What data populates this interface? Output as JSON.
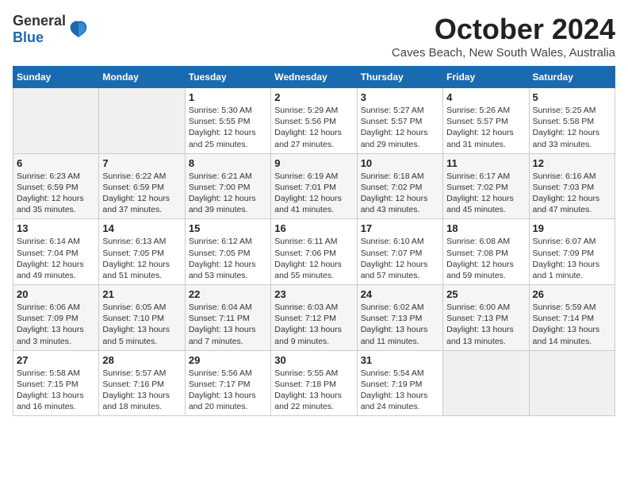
{
  "header": {
    "logo_general": "General",
    "logo_blue": "Blue",
    "month_title": "October 2024",
    "location": "Caves Beach, New South Wales, Australia"
  },
  "days_of_week": [
    "Sunday",
    "Monday",
    "Tuesday",
    "Wednesday",
    "Thursday",
    "Friday",
    "Saturday"
  ],
  "weeks": [
    [
      {
        "day": "",
        "info": ""
      },
      {
        "day": "",
        "info": ""
      },
      {
        "day": "1",
        "info": "Sunrise: 5:30 AM\nSunset: 5:55 PM\nDaylight: 12 hours and 25 minutes."
      },
      {
        "day": "2",
        "info": "Sunrise: 5:29 AM\nSunset: 5:56 PM\nDaylight: 12 hours and 27 minutes."
      },
      {
        "day": "3",
        "info": "Sunrise: 5:27 AM\nSunset: 5:57 PM\nDaylight: 12 hours and 29 minutes."
      },
      {
        "day": "4",
        "info": "Sunrise: 5:26 AM\nSunset: 5:57 PM\nDaylight: 12 hours and 31 minutes."
      },
      {
        "day": "5",
        "info": "Sunrise: 5:25 AM\nSunset: 5:58 PM\nDaylight: 12 hours and 33 minutes."
      }
    ],
    [
      {
        "day": "6",
        "info": "Sunrise: 6:23 AM\nSunset: 6:59 PM\nDaylight: 12 hours and 35 minutes."
      },
      {
        "day": "7",
        "info": "Sunrise: 6:22 AM\nSunset: 6:59 PM\nDaylight: 12 hours and 37 minutes."
      },
      {
        "day": "8",
        "info": "Sunrise: 6:21 AM\nSunset: 7:00 PM\nDaylight: 12 hours and 39 minutes."
      },
      {
        "day": "9",
        "info": "Sunrise: 6:19 AM\nSunset: 7:01 PM\nDaylight: 12 hours and 41 minutes."
      },
      {
        "day": "10",
        "info": "Sunrise: 6:18 AM\nSunset: 7:02 PM\nDaylight: 12 hours and 43 minutes."
      },
      {
        "day": "11",
        "info": "Sunrise: 6:17 AM\nSunset: 7:02 PM\nDaylight: 12 hours and 45 minutes."
      },
      {
        "day": "12",
        "info": "Sunrise: 6:16 AM\nSunset: 7:03 PM\nDaylight: 12 hours and 47 minutes."
      }
    ],
    [
      {
        "day": "13",
        "info": "Sunrise: 6:14 AM\nSunset: 7:04 PM\nDaylight: 12 hours and 49 minutes."
      },
      {
        "day": "14",
        "info": "Sunrise: 6:13 AM\nSunset: 7:05 PM\nDaylight: 12 hours and 51 minutes."
      },
      {
        "day": "15",
        "info": "Sunrise: 6:12 AM\nSunset: 7:05 PM\nDaylight: 12 hours and 53 minutes."
      },
      {
        "day": "16",
        "info": "Sunrise: 6:11 AM\nSunset: 7:06 PM\nDaylight: 12 hours and 55 minutes."
      },
      {
        "day": "17",
        "info": "Sunrise: 6:10 AM\nSunset: 7:07 PM\nDaylight: 12 hours and 57 minutes."
      },
      {
        "day": "18",
        "info": "Sunrise: 6:08 AM\nSunset: 7:08 PM\nDaylight: 12 hours and 59 minutes."
      },
      {
        "day": "19",
        "info": "Sunrise: 6:07 AM\nSunset: 7:09 PM\nDaylight: 13 hours and 1 minute."
      }
    ],
    [
      {
        "day": "20",
        "info": "Sunrise: 6:06 AM\nSunset: 7:09 PM\nDaylight: 13 hours and 3 minutes."
      },
      {
        "day": "21",
        "info": "Sunrise: 6:05 AM\nSunset: 7:10 PM\nDaylight: 13 hours and 5 minutes."
      },
      {
        "day": "22",
        "info": "Sunrise: 6:04 AM\nSunset: 7:11 PM\nDaylight: 13 hours and 7 minutes."
      },
      {
        "day": "23",
        "info": "Sunrise: 6:03 AM\nSunset: 7:12 PM\nDaylight: 13 hours and 9 minutes."
      },
      {
        "day": "24",
        "info": "Sunrise: 6:02 AM\nSunset: 7:13 PM\nDaylight: 13 hours and 11 minutes."
      },
      {
        "day": "25",
        "info": "Sunrise: 6:00 AM\nSunset: 7:13 PM\nDaylight: 13 hours and 13 minutes."
      },
      {
        "day": "26",
        "info": "Sunrise: 5:59 AM\nSunset: 7:14 PM\nDaylight: 13 hours and 14 minutes."
      }
    ],
    [
      {
        "day": "27",
        "info": "Sunrise: 5:58 AM\nSunset: 7:15 PM\nDaylight: 13 hours and 16 minutes."
      },
      {
        "day": "28",
        "info": "Sunrise: 5:57 AM\nSunset: 7:16 PM\nDaylight: 13 hours and 18 minutes."
      },
      {
        "day": "29",
        "info": "Sunrise: 5:56 AM\nSunset: 7:17 PM\nDaylight: 13 hours and 20 minutes."
      },
      {
        "day": "30",
        "info": "Sunrise: 5:55 AM\nSunset: 7:18 PM\nDaylight: 13 hours and 22 minutes."
      },
      {
        "day": "31",
        "info": "Sunrise: 5:54 AM\nSunset: 7:19 PM\nDaylight: 13 hours and 24 minutes."
      },
      {
        "day": "",
        "info": ""
      },
      {
        "day": "",
        "info": ""
      }
    ]
  ]
}
